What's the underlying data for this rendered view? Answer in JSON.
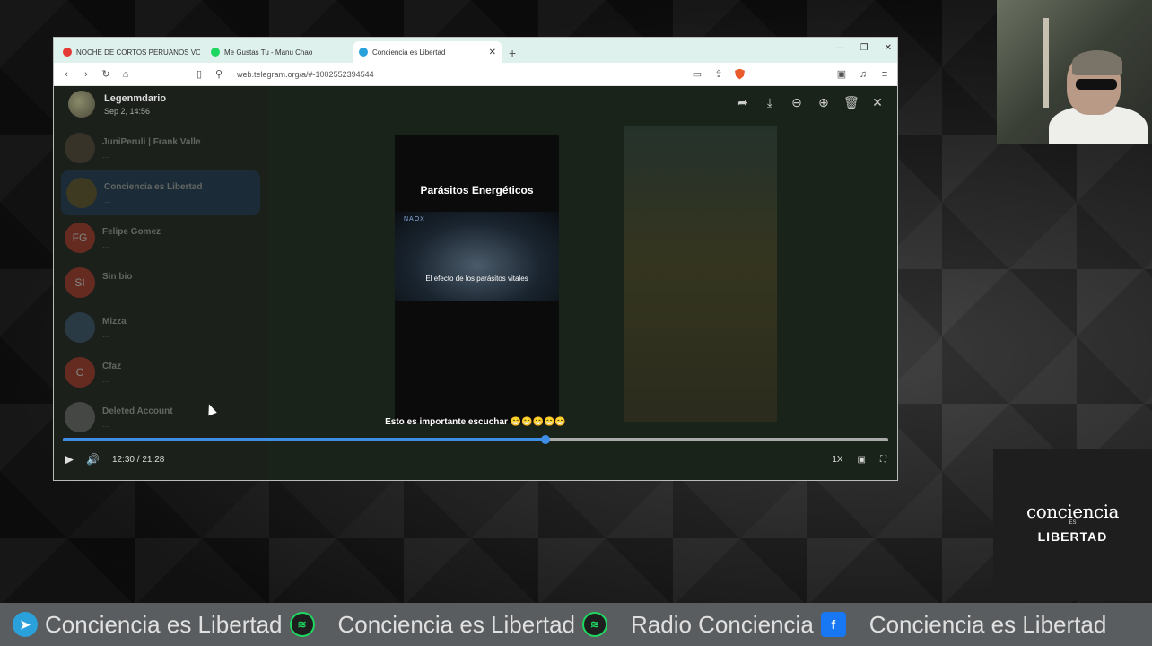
{
  "browser": {
    "tabs": [
      {
        "title": "NOCHE DE CORTOS PERUANOS VOL",
        "favicon_color": "#e53935"
      },
      {
        "title": "Me Gustas Tu - Manu Chao",
        "favicon_color": "#1ed760"
      },
      {
        "title": "Conciencia es Libertad",
        "favicon_color": "#2aa1db",
        "active": true
      }
    ],
    "new_tab": "+",
    "url": "web.telegram.org/a/#-1002552394544"
  },
  "chat_list": [
    {
      "name": "JuniPeruli | Frank Valle",
      "preview": "...",
      "color": "#5a4a3a",
      "initials": ""
    },
    {
      "name": "Conciencia es Libertad",
      "preview": "...",
      "color": "#6a5a2a",
      "initials": ""
    },
    {
      "name": "Felipe Gomez",
      "preview": "...",
      "color": "#c0392b",
      "initials": "FG"
    },
    {
      "name": "Sin bio",
      "preview": "...",
      "color": "#c0392b",
      "initials": "SI"
    },
    {
      "name": "Mizza",
      "preview": "...",
      "color": "#3a5a7a",
      "initials": ""
    },
    {
      "name": "Cfaz",
      "preview": "...",
      "color": "#c0392b",
      "initials": "C"
    },
    {
      "name": "Deleted Account",
      "preview": "...",
      "color": "#777777",
      "initials": ""
    }
  ],
  "viewer": {
    "sender": "Legenmdario",
    "date": "Sep 2, 14:56",
    "tools": [
      "share-icon",
      "download-icon",
      "zoom-out-icon",
      "zoom-in-icon",
      "delete-icon",
      "close-icon"
    ],
    "video_title": "Parásitos Energéticos",
    "video_logo": "NAOX",
    "video_subtitle": "El efecto de los parásitos vitales",
    "caption": "Esto es importante escuchar 😁😁😁😁😁",
    "progress_fraction": 0.585,
    "time": "12:30 / 21:28",
    "speed": "1X"
  },
  "brand": {
    "top": "conciencia",
    "es": "ES",
    "bottom": "LIBERTAD"
  },
  "ticker": [
    {
      "icon": "telegram-icon",
      "text": ""
    },
    {
      "icon": "",
      "text": "Conciencia es Libertad"
    },
    {
      "icon": "spotify-icon",
      "text": ""
    },
    {
      "icon": "",
      "text": "Conciencia es Libertad"
    },
    {
      "icon": "spotify-icon",
      "text": ""
    },
    {
      "icon": "",
      "text": "Radio Conciencia"
    },
    {
      "icon": "facebook-icon",
      "text": ""
    },
    {
      "icon": "",
      "text": "Conciencia es Libertad"
    }
  ]
}
